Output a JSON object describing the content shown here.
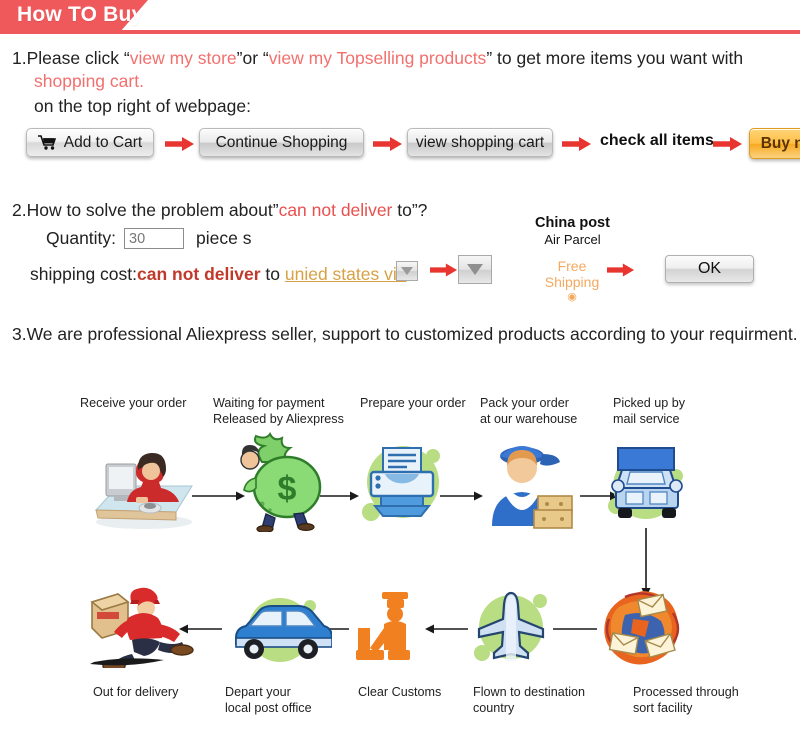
{
  "header": {
    "title": "How TO Buy",
    "accent": "#f0595b"
  },
  "steps": {
    "one": {
      "num": "1.",
      "pre": "Please click “",
      "link1": "view my store",
      "mid": "”or “",
      "link2": "view my Topselling products",
      "post": "” to get more items you want with",
      "line2_red": "shopping cart.",
      "line3": "on the top right of webpage:"
    },
    "two": {
      "num": "2.",
      "pre": "How to solve the problem about”",
      "red": "can not deliver",
      "post": " to”?",
      "qty_label": "Quantity:",
      "qty_value": "30",
      "piece_label": "piece s",
      "shipping_label": "shipping cost:",
      "shipping_red": "can not deliver",
      "shipping_to": " to ",
      "shipping_link": "unied states via"
    },
    "three": {
      "num": "3.",
      "text": "We are professional Aliexpress seller, support to customized products according to your requirment."
    }
  },
  "buttons": [
    {
      "id": "add-to-cart",
      "label": "Add to Cart",
      "style": "grey",
      "icon": "shopping-cart-icon"
    },
    {
      "id": "continue-shopping",
      "label": "Continue Shopping",
      "style": "grey2"
    },
    {
      "id": "view-shopping-cart",
      "label": "view shopping cart",
      "style": "grey2"
    },
    {
      "id": "check-all-items",
      "label": "check all items",
      "style": "plain"
    },
    {
      "id": "buy-now",
      "label": "Buy now",
      "style": "orange"
    }
  ],
  "shipping_panel": {
    "carrier_line1": "China post",
    "carrier_line2": "Air Parcel",
    "free_shipping_line1": "Free",
    "free_shipping_line2": "Shipping",
    "free_shipping_mark": "◉",
    "ok_label": "OK",
    "free_color": "#f5a95f"
  },
  "flow": {
    "row1": [
      {
        "id": "receive-order",
        "label": "Receive your order",
        "icon": "person-at-computer-icon"
      },
      {
        "id": "waiting-payment",
        "label": "Waiting for payment\nReleased by Aliexpress",
        "icon": "money-bag-icon"
      },
      {
        "id": "prepare-order",
        "label": "Prepare your order",
        "icon": "printer-icon"
      },
      {
        "id": "pack-order",
        "label": "Pack your order\nat our warehouse",
        "icon": "worker-with-boxes-icon"
      },
      {
        "id": "picked-up",
        "label": "Picked up by\nmail service",
        "icon": "truck-icon"
      }
    ],
    "row2": [
      {
        "id": "out-for-delivery",
        "label": "Out for delivery",
        "icon": "courier-running-icon"
      },
      {
        "id": "depart-post-office",
        "label": "Depart your\nlocal post office",
        "icon": "van-icon"
      },
      {
        "id": "clear-customs",
        "label": "Clear Customs",
        "icon": "customs-officer-icon"
      },
      {
        "id": "flown-destination",
        "label": "Flown to destination\ncountry",
        "icon": "airplane-icon"
      },
      {
        "id": "sort-facility",
        "label": "Processed through\nsort facility",
        "icon": "mail-pile-icon"
      }
    ]
  }
}
